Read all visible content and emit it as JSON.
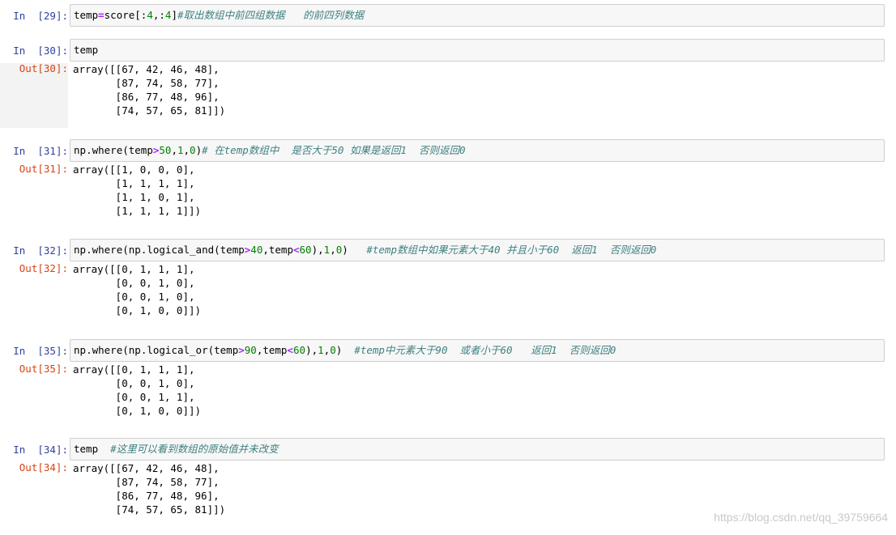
{
  "cells": [
    {
      "in_label": "In",
      "in_num": "[29]:",
      "code": [
        {
          "t": "temp",
          "c": "plain"
        },
        {
          "t": "=",
          "c": "op"
        },
        {
          "t": "score[:",
          "c": "plain"
        },
        {
          "t": "4",
          "c": "num"
        },
        {
          "t": ",:",
          "c": "plain"
        },
        {
          "t": "4",
          "c": "num"
        },
        {
          "t": "]",
          "c": "plain"
        },
        {
          "t": "#取出数组中前四组数据   的前四列数据",
          "c": "cmt"
        }
      ],
      "out_label": "",
      "output": []
    },
    {
      "in_label": "In",
      "in_num": "[30]:",
      "code": [
        {
          "t": "temp",
          "c": "plain"
        }
      ],
      "out_label": "Out[30]:",
      "output": [
        "array([[67, 42, 46, 48],",
        "       [87, 74, 58, 77],",
        "       [86, 77, 48, 96],",
        "       [74, 57, 65, 81]])"
      ]
    },
    {
      "in_label": "In",
      "in_num": "[31]:",
      "code": [
        {
          "t": "np",
          "c": "plain"
        },
        {
          "t": ".",
          "c": "plain"
        },
        {
          "t": "where(temp",
          "c": "plain"
        },
        {
          "t": ">",
          "c": "op"
        },
        {
          "t": "50",
          "c": "num"
        },
        {
          "t": ",",
          "c": "plain"
        },
        {
          "t": "1",
          "c": "num"
        },
        {
          "t": ",",
          "c": "plain"
        },
        {
          "t": "0",
          "c": "num"
        },
        {
          "t": ")",
          "c": "plain"
        },
        {
          "t": "# 在temp数组中  是否大于50 如果是返回1  否则返回0",
          "c": "cmt"
        }
      ],
      "out_label": "Out[31]:",
      "output": [
        "array([[1, 0, 0, 0],",
        "       [1, 1, 1, 1],",
        "       [1, 1, 0, 1],",
        "       [1, 1, 1, 1]])"
      ]
    },
    {
      "in_label": "In",
      "in_num": "[32]:",
      "code": [
        {
          "t": "np",
          "c": "plain"
        },
        {
          "t": ".",
          "c": "plain"
        },
        {
          "t": "where(np",
          "c": "plain"
        },
        {
          "t": ".",
          "c": "plain"
        },
        {
          "t": "logical_and(temp",
          "c": "plain"
        },
        {
          "t": ">",
          "c": "op"
        },
        {
          "t": "40",
          "c": "num"
        },
        {
          "t": ",temp",
          "c": "plain"
        },
        {
          "t": "<",
          "c": "op"
        },
        {
          "t": "60",
          "c": "num"
        },
        {
          "t": "),",
          "c": "plain"
        },
        {
          "t": "1",
          "c": "num"
        },
        {
          "t": ",",
          "c": "plain"
        },
        {
          "t": "0",
          "c": "num"
        },
        {
          "t": ")   ",
          "c": "plain"
        },
        {
          "t": "#temp数组中如果元素大于40 并且小于60  返回1  否则返回0",
          "c": "cmt"
        }
      ],
      "out_label": "Out[32]:",
      "output": [
        "array([[0, 1, 1, 1],",
        "       [0, 0, 1, 0],",
        "       [0, 0, 1, 0],",
        "       [0, 1, 0, 0]])"
      ]
    },
    {
      "in_label": "In",
      "in_num": "[35]:",
      "code": [
        {
          "t": "np",
          "c": "plain"
        },
        {
          "t": ".",
          "c": "plain"
        },
        {
          "t": "where(np",
          "c": "plain"
        },
        {
          "t": ".",
          "c": "plain"
        },
        {
          "t": "logical_or(temp",
          "c": "plain"
        },
        {
          "t": ">",
          "c": "op"
        },
        {
          "t": "90",
          "c": "num"
        },
        {
          "t": ",temp",
          "c": "plain"
        },
        {
          "t": "<",
          "c": "op"
        },
        {
          "t": "60",
          "c": "num"
        },
        {
          "t": "),",
          "c": "plain"
        },
        {
          "t": "1",
          "c": "num"
        },
        {
          "t": ",",
          "c": "plain"
        },
        {
          "t": "0",
          "c": "num"
        },
        {
          "t": ")  ",
          "c": "plain"
        },
        {
          "t": "#temp中元素大于90  或者小于60   返回1  否则返回0",
          "c": "cmt"
        }
      ],
      "out_label": "Out[35]:",
      "output": [
        "array([[0, 1, 1, 1],",
        "       [0, 0, 1, 0],",
        "       [0, 0, 1, 1],",
        "       [0, 1, 0, 0]])"
      ]
    },
    {
      "in_label": "In",
      "in_num": "[34]:",
      "code": [
        {
          "t": "temp  ",
          "c": "plain"
        },
        {
          "t": "#这里可以看到数组的原始值并未改变",
          "c": "cmt"
        }
      ],
      "out_label": "Out[34]:",
      "output": [
        "array([[67, 42, 46, 48],",
        "       [87, 74, 58, 77],",
        "       [86, 77, 48, 96],",
        "       [74, 57, 65, 81]])"
      ]
    }
  ],
  "watermark": "https://blog.csdn.net/qq_39759664"
}
